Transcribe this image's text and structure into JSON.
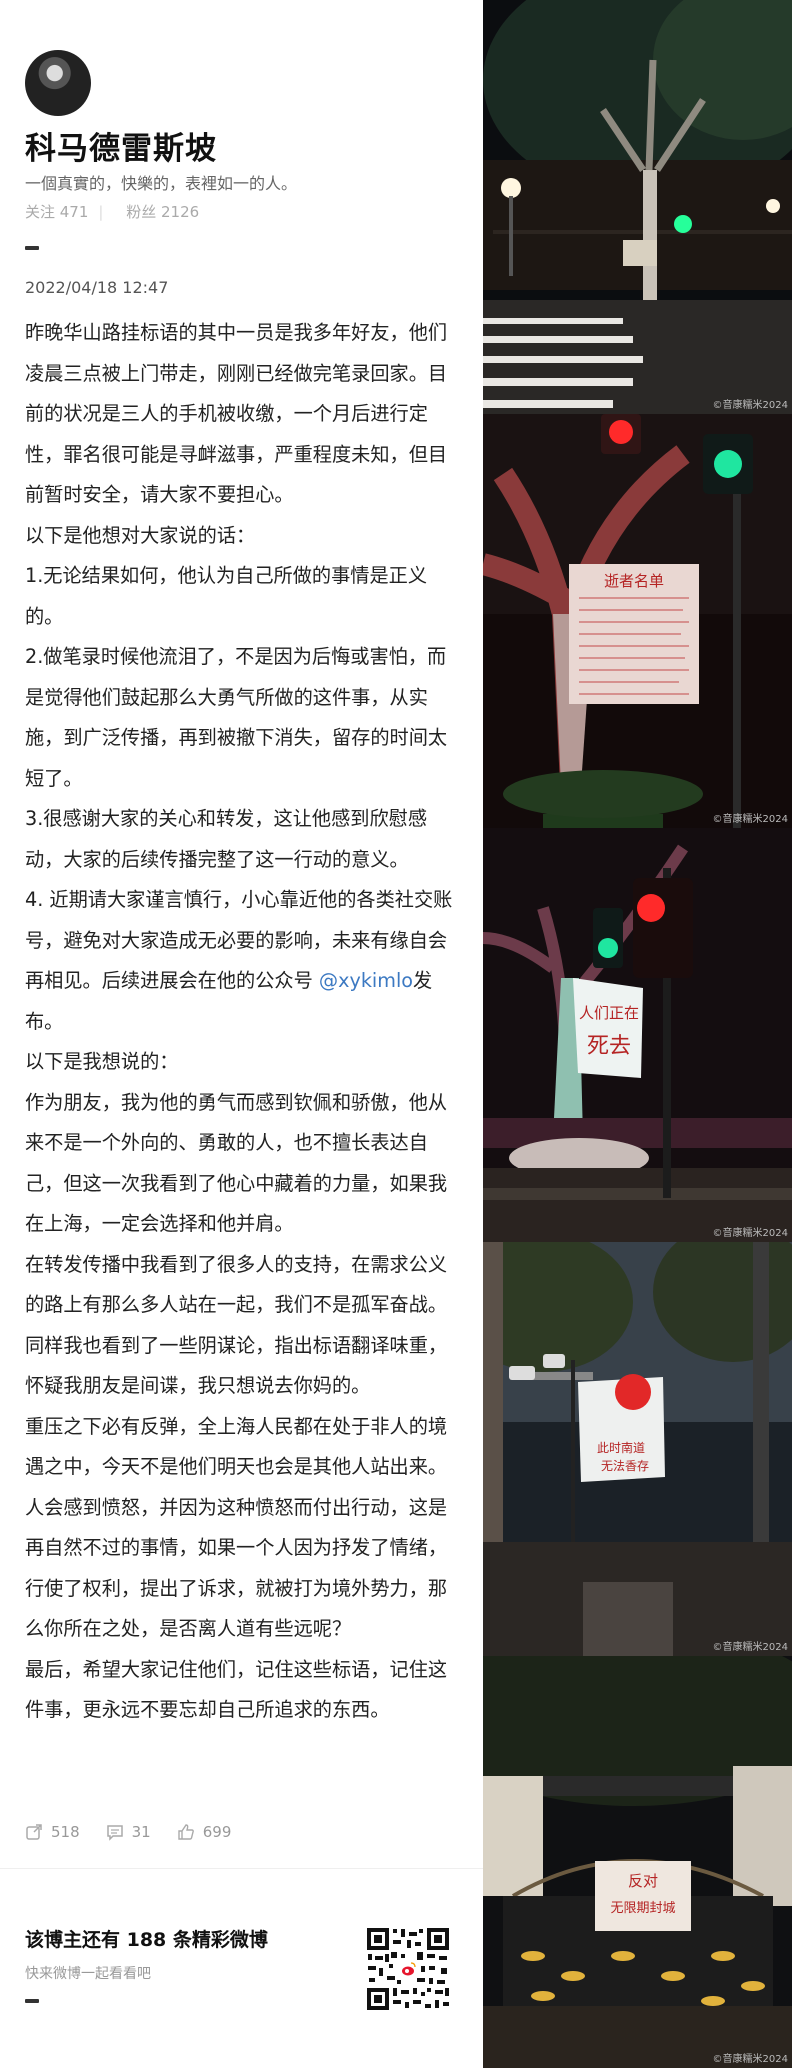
{
  "profile": {
    "name": "科马德雷斯坡",
    "bio": "一個真實的，快樂的，表裡如一的人。",
    "follow_label": "关注 471",
    "fans_label": "粉丝 2126"
  },
  "post": {
    "date": "2022/04/18 12:47",
    "paragraphs": [
      "昨晚华山路挂标语的其中一员是我多年好友，他们凌晨三点被上门带走，刚刚已经做完笔录回家。目前的状况是三人的手机被收缴，一个月后进行定性，罪名很可能是寻衅滋事，严重程度未知，但目前暂时安全，请大家不要担心。",
      "以下是他想对大家说的话：",
      "1.无论结果如何，他认为自己所做的事情是正义的。",
      "2.做笔录时候他流泪了，不是因为后悔或害怕，而是觉得他们鼓起那么大勇气所做的这件事，从实施，到广泛传播，再到被撤下消失，留存的时间太短了。",
      "3.很感谢大家的关心和转发，这让他感到欣慰感动，大家的后续传播完整了这一行动的意义。",
      "以下是我想说的：",
      "作为朋友，我为他的勇气而感到钦佩和骄傲，他从来不是一个外向的、勇敢的人，也不擅长表达自己，但这一次我看到了他心中藏着的力量，如果我在上海，一定会选择和他并肩。",
      "在转发传播中我看到了很多人的支持，在需求公义的路上有那么多人站在一起，我们不是孤军奋战。同样我也看到了一些阴谋论，指出标语翻译味重，怀疑我朋友是间谍，我只想说去你妈的。",
      "重压之下必有反弹，全上海人民都在处于非人的境遇之中，今天不是他们明天也会是其他人站出来。",
      "人会感到愤怒，并因为这种愤怒而付出行动，这是再自然不过的事情，如果一个人因为抒发了情绪，行使了权利，提出了诉求，就被打为境外势力，那么你所在之处，是否离人道有些远呢？",
      "最后，希望大家记住他们，记住这些标语，记住这件事，更永远不要忘却自己所追求的东西。"
    ],
    "p4_before": "4. 近期请大家谨言慎行，小心靠近他的各类社交账号，避免对大家造成无必要的影响，未来有缘自会再相见。后续进展会在他的公众号 ",
    "p4_handle": "@xykimlo",
    "p4_after": "发布。"
  },
  "actions": {
    "repost_count": "518",
    "comment_count": "31",
    "like_count": "699"
  },
  "footer": {
    "title": "该博主还有 188 条精彩微博",
    "subtitle": "快来微博一起看看吧"
  },
  "photos": {
    "credit": "©音康糯米2024",
    "sign1_title": "逝者名单",
    "sign2_line1": "人们正在",
    "sign2_line2": "死去",
    "sign3_line1": "此时南道",
    "sign3_line2": "无法香存",
    "sign4_line1": "反对",
    "sign4_line2": "无限期封城"
  },
  "colors": {
    "text": "#222222",
    "link": "#3c79c2",
    "muted": "#999999",
    "sign_red": "#b52424",
    "traffic_red": "#ff2a2a",
    "traffic_green": "#1fe6a0"
  }
}
